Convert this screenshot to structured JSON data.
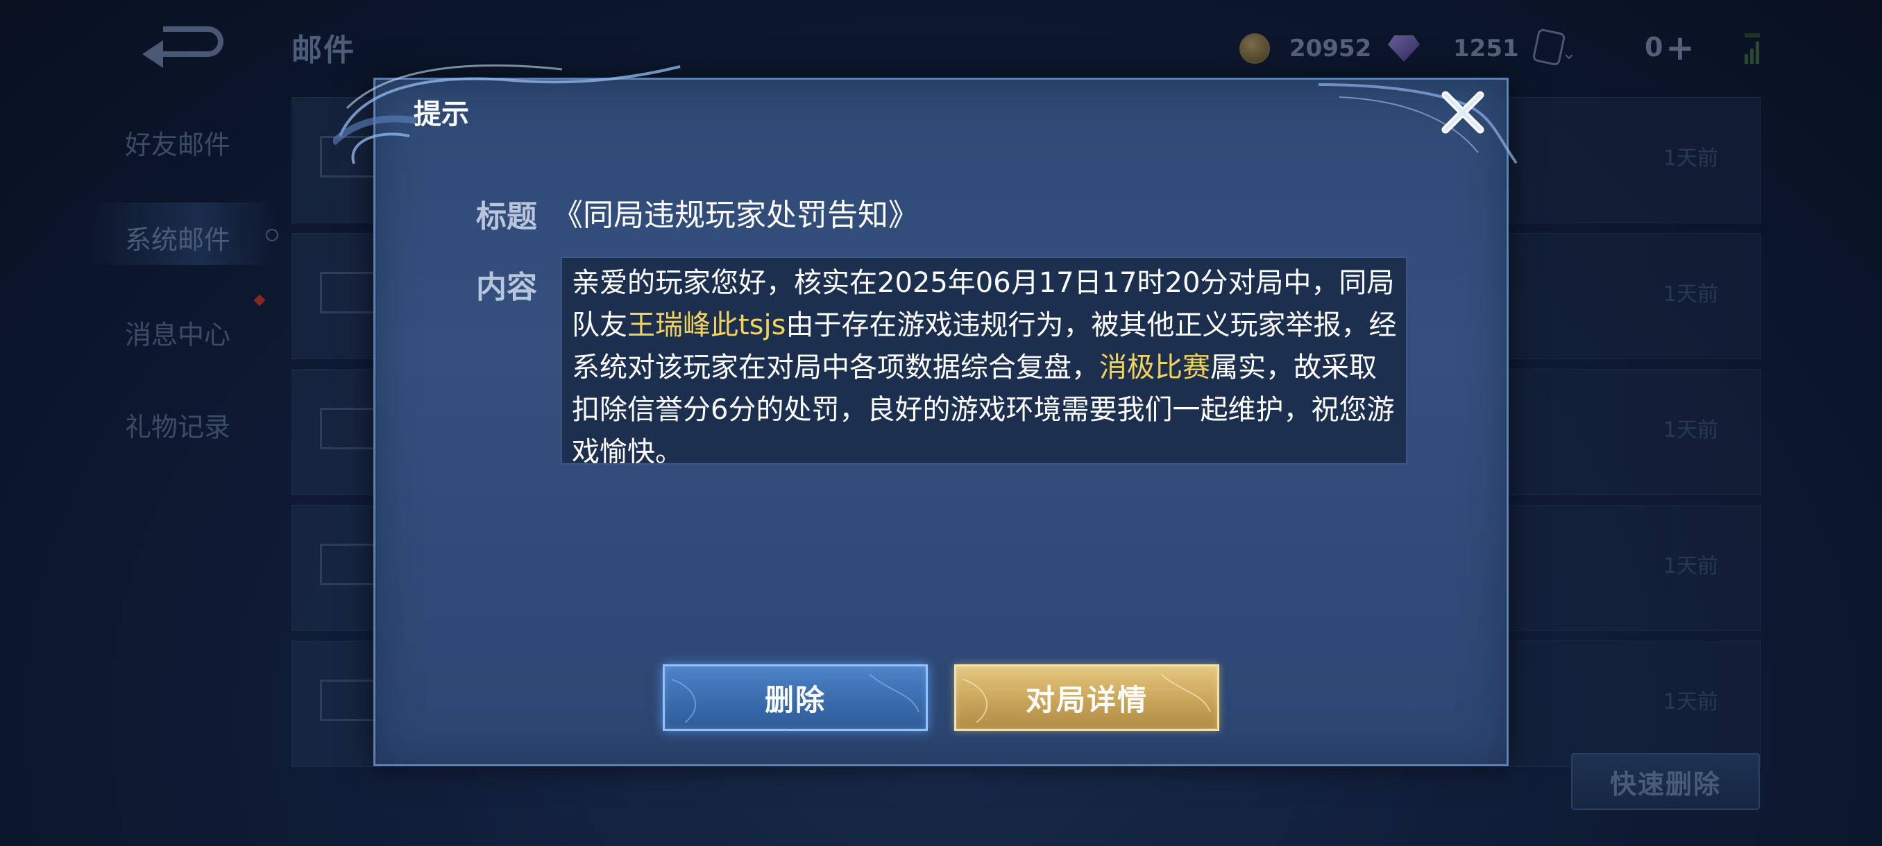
{
  "header": {
    "title": "邮件",
    "coins": "20952",
    "gems": "1251",
    "vouchers": "0"
  },
  "sidebar": {
    "items": [
      {
        "label": "好友邮件"
      },
      {
        "label": "系统邮件"
      },
      {
        "label": "消息中心"
      },
      {
        "label": "礼物记录"
      }
    ]
  },
  "mail_list": {
    "rows": [
      {
        "time": "1天前"
      },
      {
        "time": "1天前"
      },
      {
        "time": "1天前"
      },
      {
        "time": "1天前"
      },
      {
        "time": "1天前"
      }
    ],
    "quick_delete_label": "快速删除"
  },
  "dialog": {
    "title": "提示",
    "subject_label": "标题",
    "subject": "《同局违规玩家处罚告知》",
    "content_label": "内容",
    "content_parts": {
      "p1": "亲爱的玩家您好，核实在2025年06月17日17时20分对局中，同局队友",
      "player_name": "王瑞峰此tsjs",
      "p2": "由于存在游戏违规行为，被其他正义玩家举报，经系统对该玩家在对局中各项数据综合复盘，",
      "violation": "消极比赛",
      "p3": "属实，故采取扣除信誉分6分的处罚，良好的游戏环境需要我们一起维护，祝您游戏愉快。"
    },
    "delete_label": "删除",
    "details_label": "对局详情"
  },
  "colors": {
    "highlight": "#f3d35a",
    "delete_button": "#3a6cae",
    "details_button": "#c9a55a",
    "dialog_bg": "#34507d"
  }
}
